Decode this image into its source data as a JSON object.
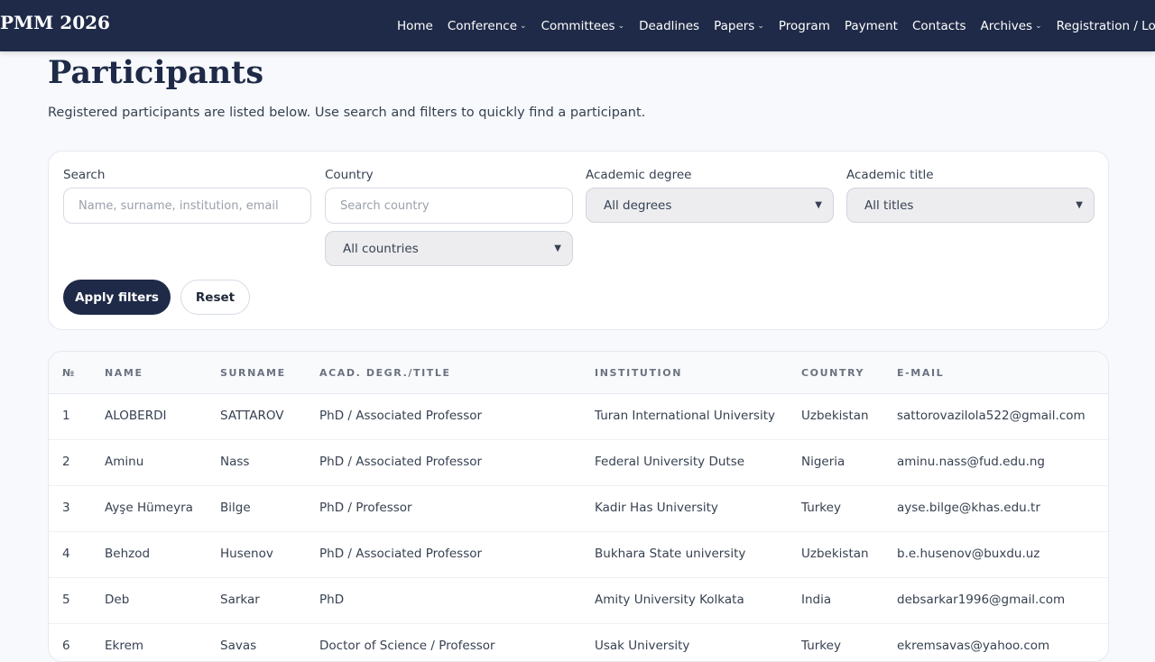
{
  "navbar": {
    "brand": "PMM 2026",
    "items": [
      {
        "label": "Home",
        "dropdown": false
      },
      {
        "label": "Conference",
        "dropdown": true
      },
      {
        "label": "Committees",
        "dropdown": true
      },
      {
        "label": "Deadlines",
        "dropdown": false
      },
      {
        "label": "Papers",
        "dropdown": true
      },
      {
        "label": "Program",
        "dropdown": false
      },
      {
        "label": "Payment",
        "dropdown": false
      },
      {
        "label": "Contacts",
        "dropdown": false
      },
      {
        "label": "Archives",
        "dropdown": true
      },
      {
        "label": "Registration / Login",
        "dropdown": false
      }
    ]
  },
  "page": {
    "title": "Participants",
    "subtitle": "Registered participants are listed below. Use search and filters to quickly find a participant."
  },
  "filters": {
    "search_label": "Search",
    "search_placeholder": "Name, surname, institution, email",
    "country_label": "Country",
    "country_placeholder": "Search country",
    "country_select": "All countries",
    "degree_label": "Academic degree",
    "degree_select": "All degrees",
    "title_label": "Academic title",
    "title_select": "All titles",
    "apply_label": "Apply filters",
    "reset_label": "Reset"
  },
  "table": {
    "columns": [
      "№",
      "NAME",
      "SURNAME",
      "ACAD. DEGR./TITLE",
      "INSTITUTION",
      "COUNTRY",
      "E-MAIL"
    ],
    "rows": [
      [
        "1",
        "ALOBERDI",
        "SATTAROV",
        "PhD / Associated Professor",
        "Turan International University",
        "Uzbekistan",
        "sattorovazilola522@gmail.com"
      ],
      [
        "2",
        "Aminu",
        "Nass",
        "PhD / Associated Professor",
        "Federal University Dutse",
        "Nigeria",
        "aminu.nass@fud.edu.ng"
      ],
      [
        "3",
        "Ayşe Hümeyra",
        "Bilge",
        "PhD / Professor",
        "Kadir Has University",
        "Turkey",
        "ayse.bilge@khas.edu.tr"
      ],
      [
        "4",
        "Behzod",
        "Husenov",
        "PhD / Associated Professor",
        "Bukhara State university",
        "Uzbekistan",
        "b.e.husenov@buxdu.uz"
      ],
      [
        "5",
        "Deb",
        "Sarkar",
        "PhD",
        "Amity University Kolkata",
        "India",
        "debsarkar1996@gmail.com"
      ],
      [
        "6",
        "Ekrem",
        "Savas",
        "Doctor of Science / Professor",
        "Usak University",
        "Turkey",
        "ekremsavas@yahoo.com"
      ]
    ]
  },
  "colors": {
    "navbar_bg": "#1e2a47",
    "accent": "#1e2a47",
    "page_bg": "#f7f9fc"
  }
}
